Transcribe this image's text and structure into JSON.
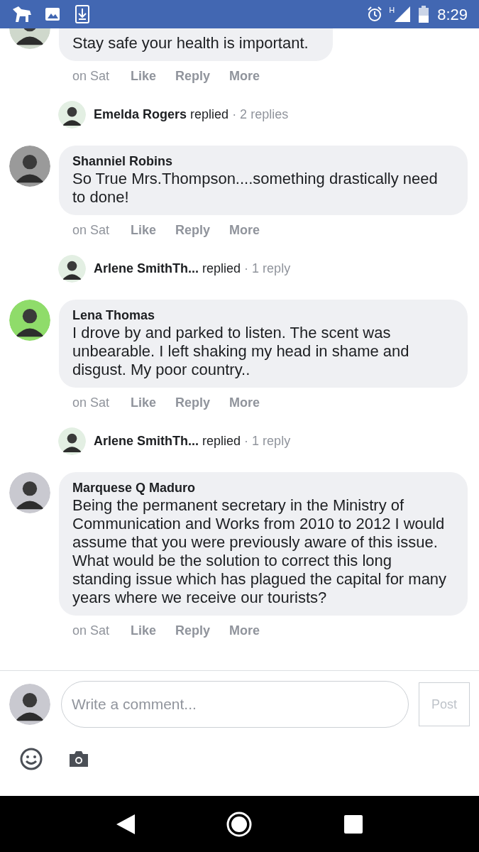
{
  "status_bar": {
    "network": "H",
    "time": "8:29"
  },
  "thread": [
    {
      "kind": "comment",
      "text": "Stay safe your health is important.",
      "time": "on Sat",
      "actions": [
        "Like",
        "Reply",
        "More"
      ],
      "cut": true
    },
    {
      "kind": "replies",
      "name": "Emelda Rogers",
      "verb": "replied",
      "count": "· 2 replies"
    },
    {
      "kind": "comment",
      "name": "Shanniel Robins",
      "text": "So True Mrs.Thompson....something drastically need to done!",
      "time": "on Sat",
      "actions": [
        "Like",
        "Reply",
        "More"
      ]
    },
    {
      "kind": "replies",
      "name": "Arlene SmithTh...",
      "verb": "replied",
      "count": "· 1 reply"
    },
    {
      "kind": "comment",
      "name": "Lena Thomas",
      "text": "I drove by and parked to listen. The scent was unbearable. I left shaking my head in shame and disgust. My poor country..",
      "time": "on Sat",
      "actions": [
        "Like",
        "Reply",
        "More"
      ]
    },
    {
      "kind": "replies",
      "name": "Arlene SmithTh...",
      "verb": "replied",
      "count": "· 1 reply"
    },
    {
      "kind": "comment",
      "name": "Marquese Q Maduro",
      "text": "Being the permanent secretary in the Ministry of Communication and Works from 2010 to 2012 I would assume that you were previously aware of this issue. What would be the solution to correct this long standing issue which has plagued the capital for many years where we receive our tourists?",
      "time": "on Sat",
      "actions": [
        "Like",
        "Reply",
        "More"
      ]
    }
  ],
  "composer": {
    "placeholder": "Write a comment...",
    "post": "Post"
  }
}
